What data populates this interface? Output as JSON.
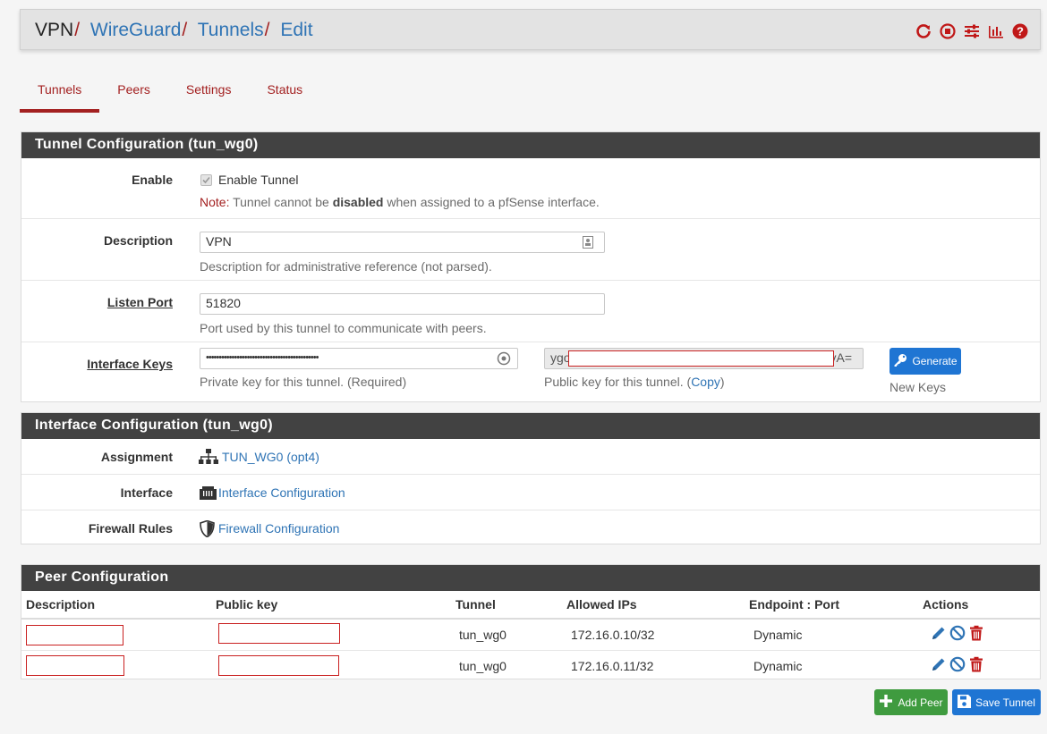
{
  "breadcrumb": {
    "root": "VPN",
    "items": [
      "WireGuard",
      "Tunnels",
      "Edit"
    ],
    "separator": "/"
  },
  "header_icons": [
    "restart-icon",
    "stop-icon",
    "settings-sliders-icon",
    "chart-icon",
    "help-icon"
  ],
  "tabs": [
    {
      "label": "Tunnels",
      "active": true
    },
    {
      "label": "Peers",
      "active": false
    },
    {
      "label": "Settings",
      "active": false
    },
    {
      "label": "Status",
      "active": false
    }
  ],
  "tunnel_config": {
    "title": "Tunnel Configuration (tun_wg0)",
    "enable": {
      "label": "Enable",
      "checkbox_label": "Enable Tunnel",
      "checked": true,
      "note_prefix": "Note:",
      "note_pre": "Tunnel cannot be",
      "note_bold": "disabled",
      "note_post": "when assigned to a pfSense interface."
    },
    "description": {
      "label": "Description",
      "value": "VPN",
      "help": "Description for administrative reference (not parsed)."
    },
    "listen_port": {
      "label": "Listen Port",
      "value": "51820",
      "help": "Port used by this tunnel to communicate with peers."
    },
    "interface_keys": {
      "label": "Interface Keys",
      "private_value": "••••••••••••••••••••••••••••••••••••••••••••",
      "private_help": "Private key for this tunnel. (Required)",
      "public_prefix": "ygo",
      "public_suffix": "yA=",
      "public_help_pre": "Public key for this tunnel. (",
      "public_help_link": "Copy",
      "public_help_post": ")",
      "generate_label": "Generate",
      "generate_help": "New Keys"
    }
  },
  "interface_config": {
    "title": "Interface Configuration (tun_wg0)",
    "assignment": {
      "label": "Assignment",
      "value": "TUN_WG0 (opt4)"
    },
    "interface": {
      "label": "Interface",
      "value": "Interface Configuration"
    },
    "firewall": {
      "label": "Firewall Rules",
      "value": "Firewall Configuration"
    }
  },
  "peer_config": {
    "title": "Peer Configuration",
    "columns": [
      "Description",
      "Public key",
      "Tunnel",
      "Allowed IPs",
      "Endpoint : Port",
      "Actions"
    ],
    "rows": [
      {
        "tunnel": "tun_wg0",
        "allowed_ips": "172.16.0.10/32",
        "endpoint": "Dynamic"
      },
      {
        "tunnel": "tun_wg0",
        "allowed_ips": "172.16.0.11/32",
        "endpoint": "Dynamic"
      }
    ]
  },
  "buttons": {
    "add_peer": "Add Peer",
    "save_tunnel": "Save Tunnel"
  },
  "colors": {
    "accent": "#a32020",
    "link": "#2f74b5",
    "panel_header": "#424242",
    "primary_button": "#1f75d3",
    "success_button": "#3f9b3f"
  }
}
